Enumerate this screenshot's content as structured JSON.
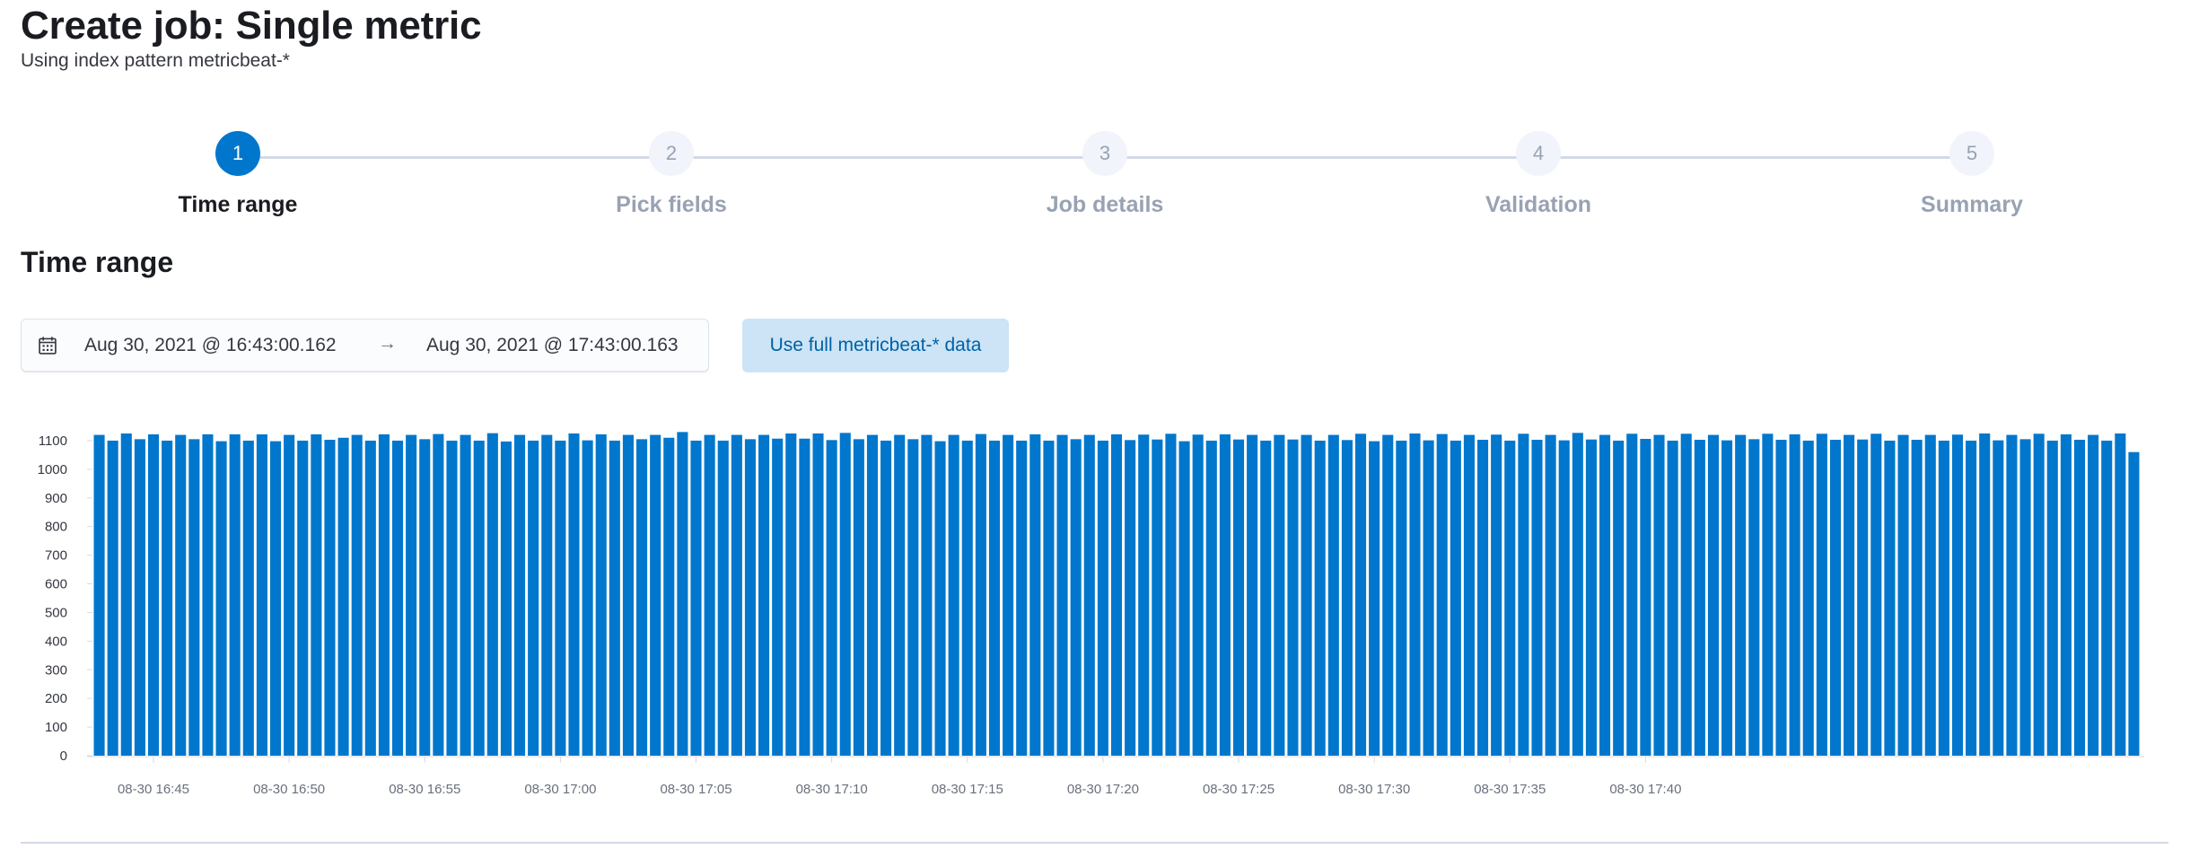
{
  "header": {
    "title": "Create job: Single metric",
    "subtitle": "Using index pattern metricbeat-*"
  },
  "steps": [
    {
      "number": "1",
      "title": "Time range",
      "status": "current"
    },
    {
      "number": "2",
      "title": "Pick fields",
      "status": "incomplete"
    },
    {
      "number": "3",
      "title": "Job details",
      "status": "incomplete"
    },
    {
      "number": "4",
      "title": "Validation",
      "status": "incomplete"
    },
    {
      "number": "5",
      "title": "Summary",
      "status": "incomplete"
    }
  ],
  "section": {
    "title": "Time range"
  },
  "date_picker": {
    "icon": "calendar-icon",
    "start": "Aug 30, 2021 @ 16:43:00.162",
    "arrow": "→",
    "end": "Aug 30, 2021 @ 17:43:00.163"
  },
  "use_full_data_button": {
    "label": "Use full metricbeat-* data"
  },
  "colors": {
    "accent": "#0077cc",
    "bar": "#0077cc",
    "button_bg": "#cce4f5",
    "button_text": "#0061a6",
    "step_inactive": "#98a2b3"
  },
  "chart_data": {
    "type": "bar",
    "title": "",
    "xlabel": "",
    "ylabel": "",
    "ylim": [
      0,
      1150
    ],
    "y_ticks": [
      0,
      100,
      200,
      300,
      400,
      500,
      600,
      700,
      800,
      900,
      1000,
      1100
    ],
    "x_tick_labels": [
      "08-30 16:45",
      "08-30 16:50",
      "08-30 16:55",
      "08-30 17:00",
      "08-30 17:05",
      "08-30 17:10",
      "08-30 17:15",
      "08-30 17:20",
      "08-30 17:25",
      "08-30 17:30",
      "08-30 17:35",
      "08-30 17:40"
    ],
    "bar_interval": "30s",
    "first_bar": "08-30 16:43:00",
    "grid": false,
    "series": [
      {
        "values": [
          1120,
          1100,
          1125,
          1105,
          1122,
          1100,
          1120,
          1105,
          1122,
          1098,
          1122,
          1100,
          1122,
          1098,
          1120,
          1100,
          1122,
          1103,
          1110,
          1120,
          1100,
          1122,
          1100,
          1120,
          1105,
          1123,
          1100,
          1120,
          1100,
          1126,
          1097,
          1120,
          1100,
          1120,
          1100,
          1125,
          1101,
          1122,
          1100,
          1120,
          1105,
          1120,
          1110,
          1130,
          1100,
          1120,
          1100,
          1120,
          1105,
          1120,
          1107,
          1125,
          1107,
          1125,
          1102,
          1127,
          1105,
          1120,
          1100,
          1120,
          1105,
          1120,
          1098,
          1120,
          1100,
          1123,
          1100,
          1120,
          1100,
          1122,
          1100,
          1120,
          1105,
          1120,
          1100,
          1122,
          1102,
          1121,
          1104,
          1124,
          1098,
          1121,
          1100,
          1122,
          1104,
          1120,
          1100,
          1120,
          1104,
          1120,
          1100,
          1120,
          1102,
          1124,
          1098,
          1120,
          1100,
          1125,
          1101,
          1123,
          1100,
          1120,
          1103,
          1121,
          1100,
          1124,
          1103,
          1120,
          1101,
          1127,
          1104,
          1120,
          1100,
          1124,
          1106,
          1120,
          1100,
          1124,
          1103,
          1120,
          1101,
          1120,
          1105,
          1124,
          1103,
          1122,
          1100,
          1124,
          1103,
          1120,
          1104,
          1124,
          1100,
          1120,
          1103,
          1120,
          1100,
          1121,
          1100,
          1125,
          1101,
          1120,
          1105,
          1124,
          1100,
          1122,
          1103,
          1120,
          1100,
          1125,
          1060
        ]
      }
    ]
  }
}
